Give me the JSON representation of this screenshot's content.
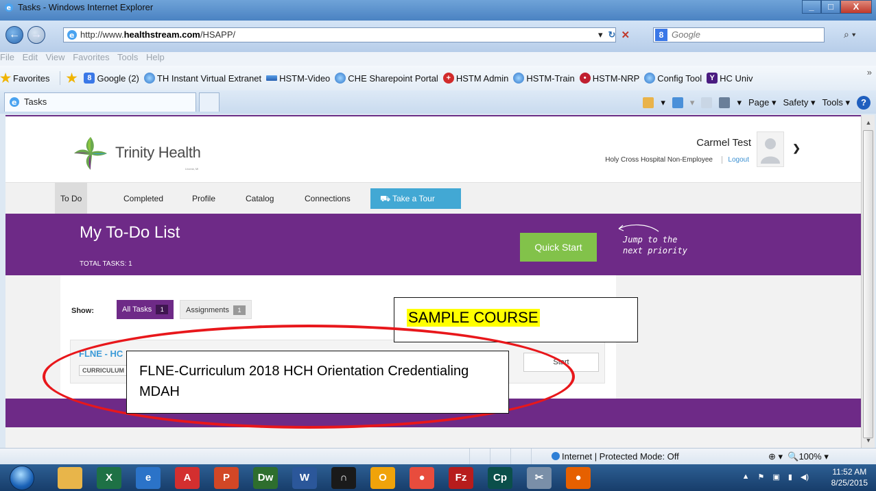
{
  "window": {
    "title": "Tasks - Windows Internet Explorer",
    "minimize": "_",
    "maximize": "□",
    "close": "X"
  },
  "address": {
    "url_prefix": "http://www.",
    "url_domain": "healthstream.com",
    "url_path": "/HSAPP/",
    "search_placeholder": "Google"
  },
  "menu": [
    "File",
    "Edit",
    "View",
    "Favorites",
    "Tools",
    "Help"
  ],
  "favorites": {
    "label": "Favorites",
    "items": [
      {
        "label": "Google (2)",
        "icon": "google-icon"
      },
      {
        "label": "TH Instant Virtual Extranet",
        "icon": "ie-icon"
      },
      {
        "label": "HSTM-Video",
        "icon": "stream-icon"
      },
      {
        "label": "CHE Sharepoint Portal",
        "icon": "ie-icon"
      },
      {
        "label": "HSTM Admin",
        "icon": "medical-cross-icon"
      },
      {
        "label": "HSTM-Train",
        "icon": "ie-icon"
      },
      {
        "label": "HSTM-NRP",
        "icon": "nrp-icon"
      },
      {
        "label": "Config Tool",
        "icon": "ie-icon"
      },
      {
        "label": "HC Univ",
        "icon": "y-icon"
      }
    ],
    "overflow": "»"
  },
  "tab": {
    "label": "Tasks"
  },
  "commandbar": {
    "page": "Page",
    "safety": "Safety",
    "tools": "Tools"
  },
  "site": {
    "logo_text": "Trinity Health",
    "logo_sub": "Livonia, MI",
    "user_name": "Carmel Test",
    "user_org": "Holy Cross Hospital Non-Employee",
    "logout": "Logout"
  },
  "nav": {
    "items": [
      "To Do",
      "Completed",
      "Profile",
      "Catalog",
      "Connections"
    ],
    "tour": "Take a Tour"
  },
  "banner": {
    "title": "My To-Do List",
    "total": "TOTAL TASKS:  1",
    "quick_start": "Quick Start",
    "jump_line1": "Jump to the",
    "jump_line2": "next priority"
  },
  "filters": {
    "show": "Show:",
    "all_label": "All Tasks",
    "all_count": "1",
    "assign_label": "Assignments",
    "assign_count": "1"
  },
  "card": {
    "title": "FLNE - HC",
    "type": "CURRICULUM",
    "start": "Start"
  },
  "annotations": {
    "sample": "SAMPLE COURSE",
    "flne": "FLNE-Curriculum 2018 HCH Orientation Credentialing MDAH"
  },
  "status": {
    "zone": "Internet | Protected Mode: Off",
    "zoom": "100%"
  },
  "clock": {
    "time": "11:52 AM",
    "date": "8/25/2015"
  },
  "taskbar": [
    {
      "name": "explorer-icon",
      "color": "#e8b54a",
      "glyph": ""
    },
    {
      "name": "excel-icon",
      "color": "#1e7145",
      "glyph": "X"
    },
    {
      "name": "ie-icon",
      "color": "#2b73c8",
      "glyph": "e"
    },
    {
      "name": "acrobat-icon",
      "color": "#d32f2f",
      "glyph": "A"
    },
    {
      "name": "powerpoint-icon",
      "color": "#d24726",
      "glyph": "P"
    },
    {
      "name": "dreamweaver-icon",
      "color": "#2e6e2e",
      "glyph": "Dw"
    },
    {
      "name": "word-icon",
      "color": "#2b579a",
      "glyph": "W"
    },
    {
      "name": "headphones-icon",
      "color": "#1a1a1a",
      "glyph": "∩"
    },
    {
      "name": "outlook-icon",
      "color": "#f0a30a",
      "glyph": "O"
    },
    {
      "name": "chrome-icon",
      "color": "#e84c3d",
      "glyph": "●"
    },
    {
      "name": "filezilla-icon",
      "color": "#b71c1c",
      "glyph": "Fz"
    },
    {
      "name": "captivate-icon",
      "color": "#0b4f4a",
      "glyph": "Cp"
    },
    {
      "name": "snipping-icon",
      "color": "#7a8fa8",
      "glyph": "✂"
    },
    {
      "name": "firefox-icon",
      "color": "#e66000",
      "glyph": "●"
    }
  ],
  "colors": {
    "brand_purple": "#6e2a87",
    "quick_start_green": "#82c24a",
    "tour_blue": "#42a8d4",
    "annotation_red": "#e8171b",
    "highlight_yellow": "#ffff00"
  }
}
